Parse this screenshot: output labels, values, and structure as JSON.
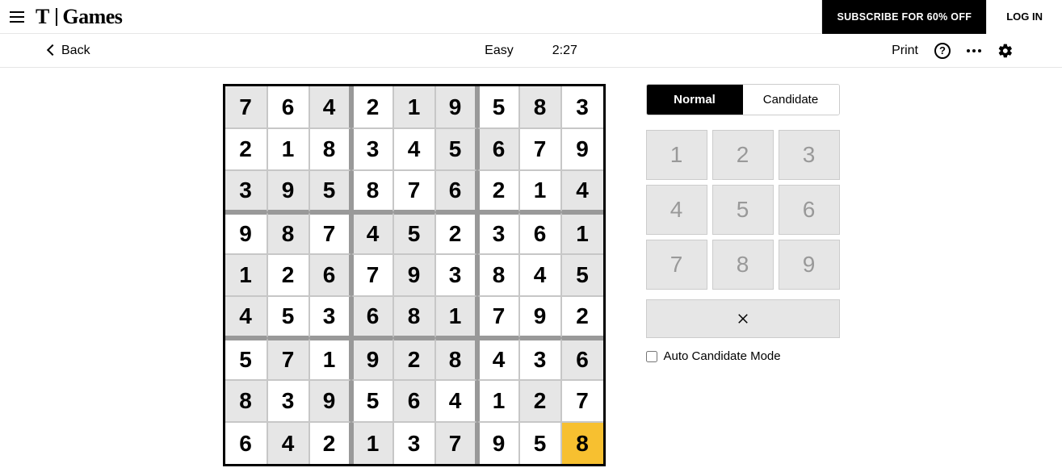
{
  "header": {
    "logo_letter": "T",
    "logo_word": "Games",
    "subscribe_label": "SUBSCRIBE FOR 60% OFF",
    "login_label": "LOG IN"
  },
  "toolbar": {
    "back_label": "Back",
    "difficulty": "Easy",
    "timer": "2:27",
    "print_label": "Print"
  },
  "panel": {
    "mode_normal": "Normal",
    "mode_candidate": "Candidate",
    "keys": [
      "1",
      "2",
      "3",
      "4",
      "5",
      "6",
      "7",
      "8",
      "9"
    ],
    "auto_candidate_label": "Auto Candidate Mode"
  },
  "sudoku": {
    "grid": [
      [
        {
          "v": "7",
          "given": true
        },
        {
          "v": "6",
          "given": false
        },
        {
          "v": "4",
          "given": true
        },
        {
          "v": "2",
          "given": false
        },
        {
          "v": "1",
          "given": true
        },
        {
          "v": "9",
          "given": true
        },
        {
          "v": "5",
          "given": false
        },
        {
          "v": "8",
          "given": true
        },
        {
          "v": "3",
          "given": false
        }
      ],
      [
        {
          "v": "2",
          "given": false
        },
        {
          "v": "1",
          "given": false
        },
        {
          "v": "8",
          "given": false
        },
        {
          "v": "3",
          "given": false
        },
        {
          "v": "4",
          "given": false
        },
        {
          "v": "5",
          "given": true
        },
        {
          "v": "6",
          "given": true
        },
        {
          "v": "7",
          "given": false
        },
        {
          "v": "9",
          "given": false
        }
      ],
      [
        {
          "v": "3",
          "given": true
        },
        {
          "v": "9",
          "given": true
        },
        {
          "v": "5",
          "given": true
        },
        {
          "v": "8",
          "given": false
        },
        {
          "v": "7",
          "given": false
        },
        {
          "v": "6",
          "given": true
        },
        {
          "v": "2",
          "given": false
        },
        {
          "v": "1",
          "given": false
        },
        {
          "v": "4",
          "given": true
        }
      ],
      [
        {
          "v": "9",
          "given": false
        },
        {
          "v": "8",
          "given": true
        },
        {
          "v": "7",
          "given": false
        },
        {
          "v": "4",
          "given": true
        },
        {
          "v": "5",
          "given": true
        },
        {
          "v": "2",
          "given": false
        },
        {
          "v": "3",
          "given": false
        },
        {
          "v": "6",
          "given": false
        },
        {
          "v": "1",
          "given": true
        }
      ],
      [
        {
          "v": "1",
          "given": true
        },
        {
          "v": "2",
          "given": false
        },
        {
          "v": "6",
          "given": true
        },
        {
          "v": "7",
          "given": false
        },
        {
          "v": "9",
          "given": true
        },
        {
          "v": "3",
          "given": false
        },
        {
          "v": "8",
          "given": false
        },
        {
          "v": "4",
          "given": false
        },
        {
          "v": "5",
          "given": true
        }
      ],
      [
        {
          "v": "4",
          "given": true
        },
        {
          "v": "5",
          "given": false
        },
        {
          "v": "3",
          "given": false
        },
        {
          "v": "6",
          "given": true
        },
        {
          "v": "8",
          "given": true
        },
        {
          "v": "1",
          "given": true
        },
        {
          "v": "7",
          "given": false
        },
        {
          "v": "9",
          "given": false
        },
        {
          "v": "2",
          "given": false
        }
      ],
      [
        {
          "v": "5",
          "given": false
        },
        {
          "v": "7",
          "given": true
        },
        {
          "v": "1",
          "given": false
        },
        {
          "v": "9",
          "given": true
        },
        {
          "v": "2",
          "given": true
        },
        {
          "v": "8",
          "given": true
        },
        {
          "v": "4",
          "given": false
        },
        {
          "v": "3",
          "given": false
        },
        {
          "v": "6",
          "given": true
        }
      ],
      [
        {
          "v": "8",
          "given": true
        },
        {
          "v": "3",
          "given": false
        },
        {
          "v": "9",
          "given": true
        },
        {
          "v": "5",
          "given": false
        },
        {
          "v": "6",
          "given": true
        },
        {
          "v": "4",
          "given": false
        },
        {
          "v": "1",
          "given": false
        },
        {
          "v": "2",
          "given": true
        },
        {
          "v": "7",
          "given": false
        }
      ],
      [
        {
          "v": "6",
          "given": false
        },
        {
          "v": "4",
          "given": true
        },
        {
          "v": "2",
          "given": false
        },
        {
          "v": "1",
          "given": true
        },
        {
          "v": "3",
          "given": false
        },
        {
          "v": "7",
          "given": true
        },
        {
          "v": "9",
          "given": false
        },
        {
          "v": "5",
          "given": false
        },
        {
          "v": "8",
          "given": false,
          "selected": true
        }
      ]
    ]
  }
}
